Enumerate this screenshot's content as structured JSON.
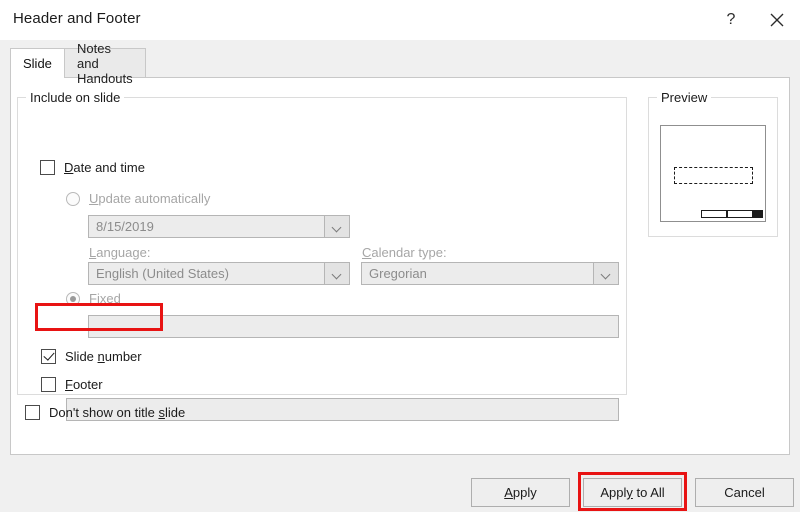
{
  "window": {
    "title": "Header and Footer",
    "help_icon": "question-mark-icon",
    "close_icon": "close-x-icon"
  },
  "tabs": [
    {
      "label": "Slide",
      "active": true
    },
    {
      "label": "Notes and Handouts",
      "active": false
    }
  ],
  "include_group": {
    "label": "Include on slide",
    "date_and_time": {
      "label": "Date and time",
      "accelerator": "D",
      "checked": false,
      "enabled": true
    },
    "update_automatically": {
      "label": "Update automatically",
      "accelerator": "U",
      "selected": false,
      "enabled": false,
      "date_value": "8/15/2019",
      "dropdown_icon": "chevron-down-icon"
    },
    "language": {
      "label": "Language:",
      "accelerator": "L",
      "value": "English (United States)",
      "enabled": false,
      "dropdown_icon": "chevron-down-icon"
    },
    "calendar_type": {
      "label": "Calendar type:",
      "accelerator": "C",
      "value": "Gregorian",
      "enabled": false,
      "dropdown_icon": "chevron-down-icon"
    },
    "fixed": {
      "label": "Fixed",
      "accelerator": "x",
      "selected": true,
      "enabled": false,
      "value": ""
    },
    "slide_number": {
      "label": "Slide number",
      "accelerator": "n",
      "checked": true,
      "enabled": true,
      "highlighted": true
    },
    "footer": {
      "label": "Footer",
      "accelerator": "F",
      "checked": false,
      "enabled": true,
      "value": ""
    }
  },
  "dont_show_on_title_slide": {
    "label": "Don't show on title slide",
    "accelerator": "s",
    "checked": false
  },
  "preview": {
    "label": "Preview",
    "slide_number_active": true
  },
  "buttons": {
    "apply": {
      "label": "Apply",
      "accelerator": "A"
    },
    "apply_to_all": {
      "label": "Apply to All",
      "accelerator": "y",
      "highlighted": true
    },
    "cancel": {
      "label": "Cancel"
    }
  },
  "colors": {
    "annotation": "#e81313",
    "dialog_background": "#f0f0f0",
    "page_background": "#ffffff",
    "disabled_text": "#a6a6a6"
  }
}
